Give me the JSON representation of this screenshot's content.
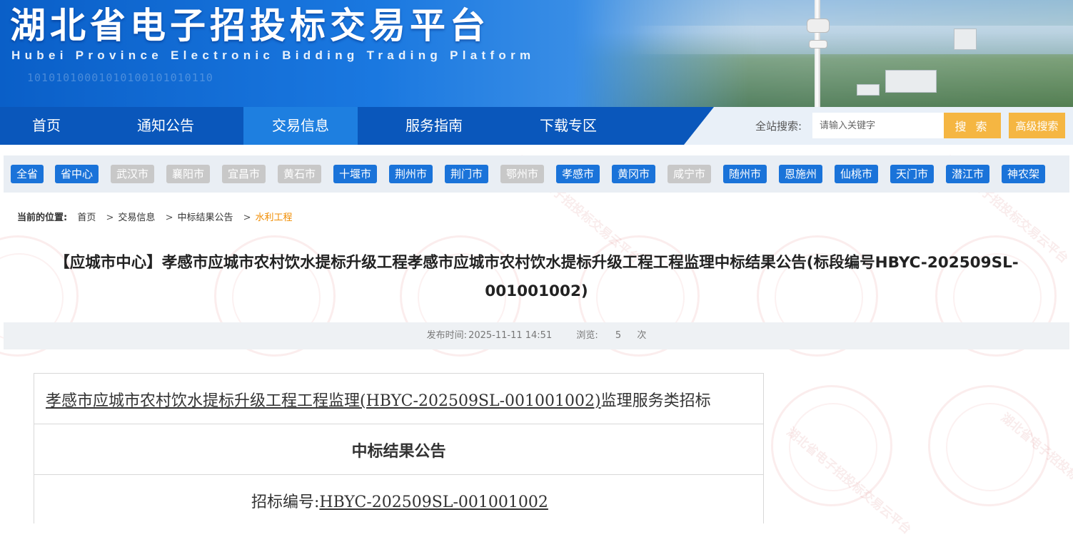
{
  "header": {
    "title": "湖北省电子招投标交易平台",
    "subtitle": "Hubei Province Electronic Bidding Trading Platform",
    "binary": "10101010001010100101010110"
  },
  "nav": {
    "items": [
      {
        "label": "首页"
      },
      {
        "label": "通知公告"
      },
      {
        "label": "交易信息",
        "active": true
      },
      {
        "label": "服务指南"
      },
      {
        "label": "下载专区"
      }
    ],
    "search_label": "全站搜索:",
    "search_placeholder": "请输入关键字",
    "search_button": "搜 索",
    "advanced_search_button": "高级搜索"
  },
  "cities": [
    {
      "label": "全省",
      "enabled": true
    },
    {
      "label": "省中心",
      "enabled": true
    },
    {
      "label": "武汉市",
      "enabled": false
    },
    {
      "label": "襄阳市",
      "enabled": false
    },
    {
      "label": "宜昌市",
      "enabled": false
    },
    {
      "label": "黄石市",
      "enabled": false
    },
    {
      "label": "十堰市",
      "enabled": true
    },
    {
      "label": "荆州市",
      "enabled": true
    },
    {
      "label": "荆门市",
      "enabled": true
    },
    {
      "label": "鄂州市",
      "enabled": false
    },
    {
      "label": "孝感市",
      "enabled": true
    },
    {
      "label": "黄冈市",
      "enabled": true
    },
    {
      "label": "咸宁市",
      "enabled": false
    },
    {
      "label": "随州市",
      "enabled": true
    },
    {
      "label": "恩施州",
      "enabled": true
    },
    {
      "label": "仙桃市",
      "enabled": true
    },
    {
      "label": "天门市",
      "enabled": true
    },
    {
      "label": "潜江市",
      "enabled": true
    },
    {
      "label": "神农架",
      "enabled": true
    }
  ],
  "breadcrumb": {
    "label": "当前的位置:",
    "items": [
      "首页",
      "交易信息",
      "中标结果公告"
    ],
    "current": "水利工程"
  },
  "article": {
    "title_line1": "【应城市中心】孝感市应城市农村饮水提标升级工程孝感市应城市农村饮水提标升级工程工程监理中标结果公告(标段编号HBYC-202509SL-",
    "title_line2": "001001002)",
    "publish_label": "发布时间:",
    "publish_time": "2025-11-11 14:51",
    "views_label": "浏览:",
    "views_count": "5",
    "views_unit": "次"
  },
  "document": {
    "project_name_linked": "孝感市应城市农村饮水提标升级工程工程监理(HBYC-202509SL-001001002)",
    "project_suffix": "监理服务类招标",
    "heading": "中标结果公告",
    "code_label": "招标编号:",
    "code_value": "HBYC-202509SL-001001002"
  },
  "watermark": {
    "text": "湖北省电子招投标交易云平台"
  },
  "colors": {
    "nav_blue": "#0a57bb",
    "nav_active": "#1e7fe0",
    "city_active": "#1a73d9",
    "city_disabled": "#c8c8c8",
    "search_orange": "#f5b642",
    "breadcrumb_current": "#f08c00"
  }
}
